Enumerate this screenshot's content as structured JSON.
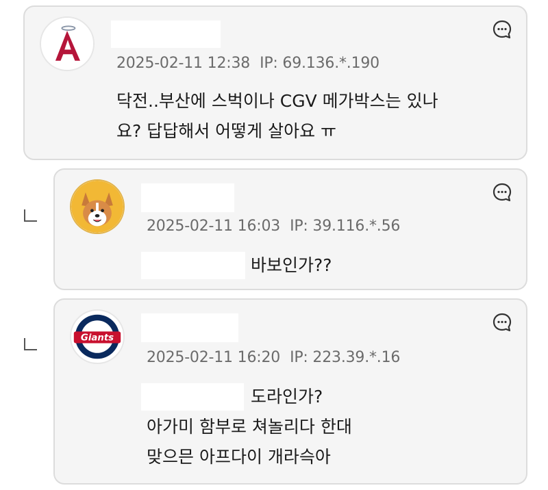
{
  "comments": [
    {
      "date": "2025-02-11 12:38",
      "ip": "IP: 69.136.*.190",
      "lines": [
        "닥전..부산에 스벅이나 CGV 메가박스는 있나",
        "요? 답답해서 어떻게 살아요 ㅠ"
      ],
      "avatar": "angels-logo",
      "avatar_letter": "A"
    },
    {
      "date": "2025-02-11 16:03",
      "ip": "IP: 39.116.*.56",
      "lines": [
        "바보인가??"
      ],
      "avatar": "dog-avatar"
    },
    {
      "date": "2025-02-11 16:20",
      "ip": "IP: 223.39.*.16",
      "lines": [
        "도라인가?",
        "아가미 함부로 쳐놀리다 한대",
        "맞으믄 아프다이 개라슥아"
      ],
      "avatar": "giants-logo",
      "avatar_wordmark": "Giants"
    }
  ],
  "colors": {
    "card_bg": "#f5f5f5",
    "card_border": "#dcdcdc",
    "meta_text": "#6b6b6b",
    "body_text": "#1a1a1a",
    "angels_red": "#b5153a",
    "giants_red": "#c8102e",
    "giants_navy": "#0a2a5e"
  },
  "icons": [
    "comment-reply-icon",
    "thread-reply-marker-icon"
  ]
}
